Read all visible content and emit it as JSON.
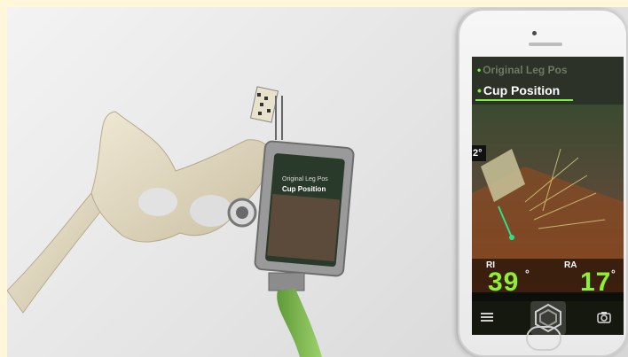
{
  "app": {
    "menu": {
      "items": [
        {
          "label": "Original Leg Pos",
          "active": false
        },
        {
          "label": "Cup Position",
          "active": true
        }
      ]
    },
    "angle_tag": "2°",
    "readout": {
      "ri_label": "RI",
      "ri_value": "39",
      "ra_label": "RA",
      "ra_value": "17",
      "degree_symbol": "°"
    },
    "toolbar": {
      "left_icon": "hamburger-menu-icon",
      "center_icon": "hexagon-logo-icon",
      "right_icon": "camera-icon"
    },
    "accent_color": "#8cf22e"
  },
  "scene": {
    "mini_phone_menu": [
      "Original Leg Pos",
      "Cup Position"
    ]
  }
}
